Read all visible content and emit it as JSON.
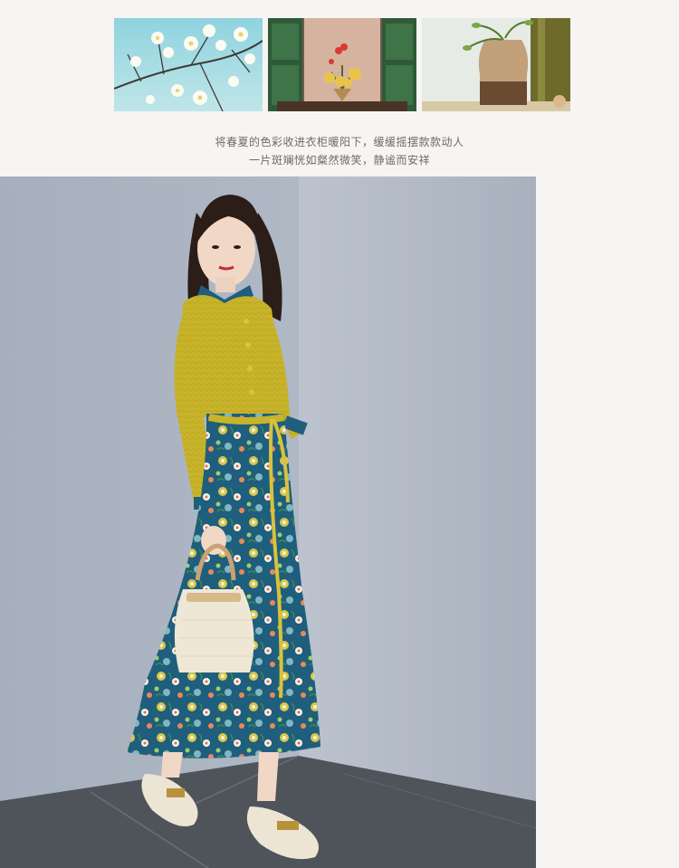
{
  "thumbnails": [
    {
      "subject": "blossom-branch-sky"
    },
    {
      "subject": "window-flower-pot"
    },
    {
      "subject": "ceramic-vase"
    }
  ],
  "caption": {
    "line1": "将春夏的色彩收进衣柜暖阳下，缓缓摇摆款款动人",
    "line2": "一片斑斓恍如粲然微笑，静谧而安祥"
  },
  "photo": {
    "subject": "model-in-patchwork-floral-dress"
  },
  "colors": {
    "page_bg": "#f6f5f3",
    "wall": "#a9b1bf",
    "floor": "#4f545b",
    "cardigan_yellow": "#c9b52a",
    "skirt_teal": "#1f5e7d",
    "caption_text": "#6f6a66"
  }
}
